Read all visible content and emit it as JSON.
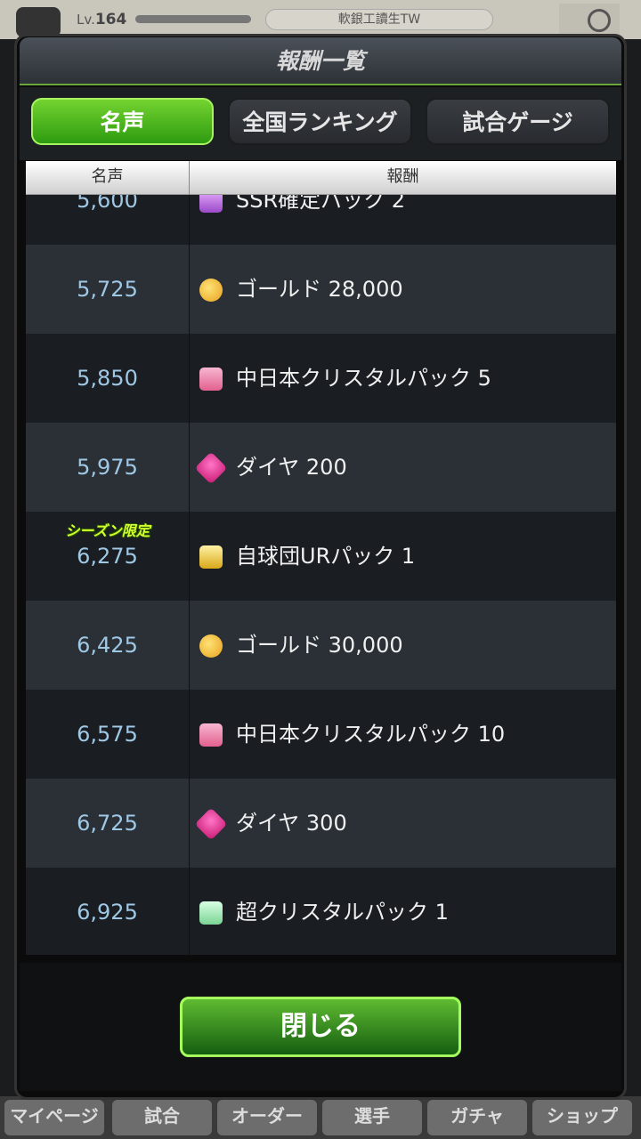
{
  "background": {
    "level_prefix": "Lv.",
    "level_value": "164",
    "player_name": "軟銀工讀生TW",
    "bottom_tabs": [
      "マイページ",
      "試合",
      "オーダー",
      "選手",
      "ガチャ",
      "ショップ"
    ]
  },
  "dialog": {
    "title": "報酬一覧",
    "tabs": [
      {
        "label": "名声",
        "active": true
      },
      {
        "label": "全国ランキング",
        "active": false
      },
      {
        "label": "試合ゲージ",
        "active": false
      }
    ],
    "table": {
      "columns": [
        "名声",
        "報酬"
      ],
      "rows": [
        {
          "fame": "5,600",
          "reward": "SSR確定パック 2",
          "icon": "ssr-pack-icon"
        },
        {
          "fame": "5,725",
          "reward": "ゴールド 28,000",
          "icon": "gold-icon"
        },
        {
          "fame": "5,850",
          "reward": "中日本クリスタルパック 5",
          "icon": "crystal-pack-icon"
        },
        {
          "fame": "5,975",
          "reward": "ダイヤ 200",
          "icon": "diamond-icon"
        },
        {
          "fame": "6,275",
          "reward": "自球団URパック 1",
          "icon": "ur-pack-icon",
          "season_limited": "シーズン限定"
        },
        {
          "fame": "6,425",
          "reward": "ゴールド 30,000",
          "icon": "gold-icon"
        },
        {
          "fame": "6,575",
          "reward": "中日本クリスタルパック 10",
          "icon": "crystal-pack-icon"
        },
        {
          "fame": "6,725",
          "reward": "ダイヤ 300",
          "icon": "diamond-icon"
        },
        {
          "fame": "6,925",
          "reward": "超クリスタルパック 1",
          "icon": "super-crystal-pack-icon"
        }
      ]
    },
    "close_label": "閉じる"
  }
}
